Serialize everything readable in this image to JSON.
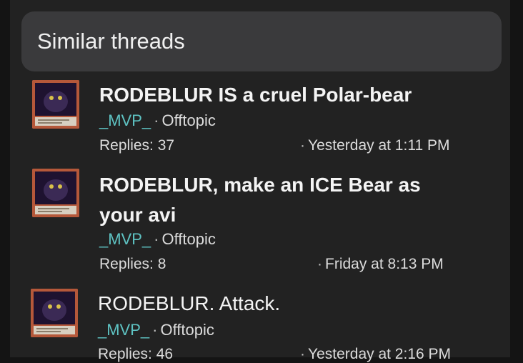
{
  "header": {
    "title": "Similar threads"
  },
  "threads": [
    {
      "title": "RODEBLUR IS a cruel Polar-bear",
      "author": "_MVP_",
      "forum": "Offtopic",
      "replies": "Replies: 37",
      "date": "Yesterday at 1:11 PM",
      "title_bold": true
    },
    {
      "title": "RODEBLUR, make an ICE Bear as your avi",
      "author": "_MVP_",
      "forum": "Offtopic",
      "replies": "Replies: 8",
      "date": "Friday at 8:13 PM",
      "title_bold": true
    },
    {
      "title": "RODEBLUR. Attack.",
      "author": "_MVP_",
      "forum": "Offtopic",
      "replies": "Replies: 46",
      "date": "Yesterday at 2:16 PM",
      "title_bold": false
    }
  ],
  "separator": "·",
  "colors": {
    "username": "#5ec3c3",
    "background": "#222222",
    "header_bg": "#3a3a3c"
  }
}
